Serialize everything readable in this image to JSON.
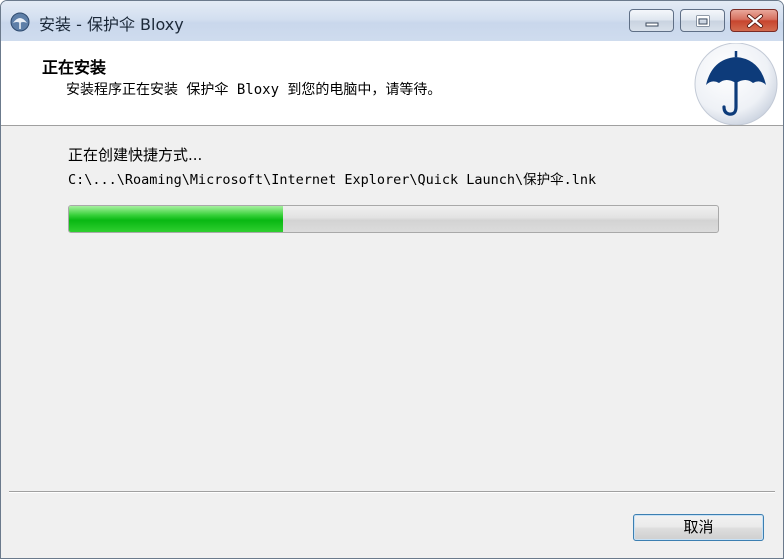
{
  "window": {
    "title": "安装 - 保护伞 Bloxy",
    "icon": "installer-icon"
  },
  "title_buttons": {
    "minimize_icon": "minimize-icon",
    "maximize_icon": "maximize-icon",
    "close_icon": "close-icon"
  },
  "header": {
    "title": "正在安装",
    "subtitle": "安装程序正在安装 保护伞 Bloxy 到您的电脑中，请等待。",
    "logo_icon": "umbrella-icon"
  },
  "main": {
    "status": "正在创建快捷方式...",
    "path": "C:\\...\\Roaming\\Microsoft\\Internet Explorer\\Quick Launch\\保护伞.lnk",
    "progress": 0.33
  },
  "footer": {
    "cancel_label": "取消"
  },
  "colors": {
    "progress_fill": "#0bb815",
    "umbrella_blue": "#0d3b7a",
    "close_button": "#c7452e"
  }
}
